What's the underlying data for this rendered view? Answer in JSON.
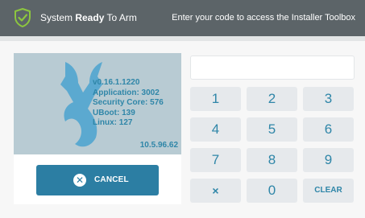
{
  "status_bar": {
    "status_prefix": "System ",
    "status_bold": "Ready",
    "status_suffix": " To Arm",
    "hint": "Enter your code to access the Installer Toolbox",
    "shield_icon": "shield-check-icon"
  },
  "info": {
    "lines": [
      "v0.16.1.1220",
      "Application: 3002",
      "Security Core: 576",
      "UBoot: 139",
      "Linux: 127"
    ],
    "ip": "10.5.96.62",
    "logo_icon": "wrench-logo-icon"
  },
  "cancel": {
    "label": "CANCEL",
    "icon": "close-circle-icon"
  },
  "code_input": {
    "value": ""
  },
  "keypad": {
    "keys": [
      "1",
      "2",
      "3",
      "4",
      "5",
      "6",
      "7",
      "8",
      "9",
      "×",
      "0",
      "CLEAR"
    ]
  },
  "colors": {
    "status_bar": "#5c6468",
    "accent": "#2c7ea3",
    "key_bg": "#e6e9ec",
    "info_panel": "#b8cbd3",
    "shield": "#8dc63f"
  }
}
